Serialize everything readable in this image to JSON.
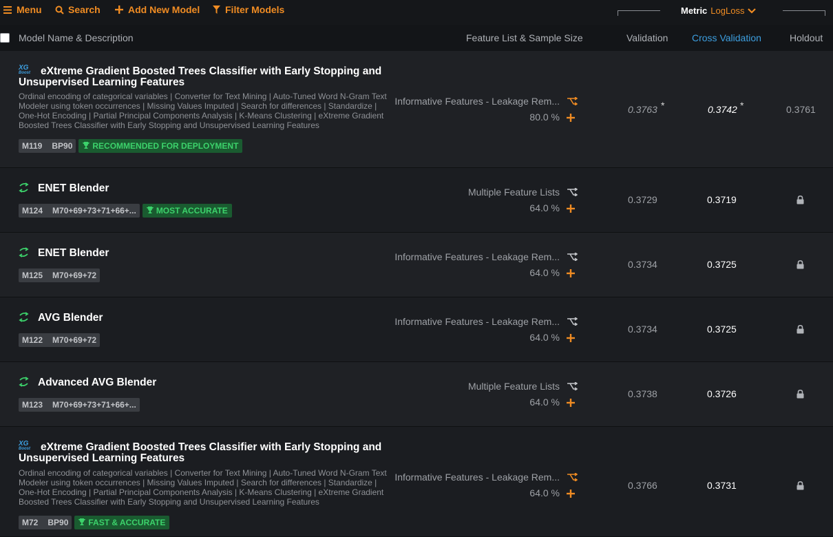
{
  "topbar": {
    "menu_label": "Menu",
    "search_label": "Search",
    "add_model_label": "Add New Model",
    "filter_label": "Filter Models",
    "metric_label": "Metric",
    "metric_value": "LogLoss"
  },
  "columns": {
    "model": "Model Name & Description",
    "feature": "Feature List & Sample Size",
    "validation": "Validation",
    "cross_validation": "Cross Validation",
    "holdout": "Holdout"
  },
  "rows": [
    {
      "icon": "xgboost-icon",
      "icon_text_top": "XG",
      "icon_text_bottom": "Boost",
      "title": "eXtreme Gradient Boosted Trees Classifier with Early Stopping and Unsupervised Learning Features",
      "description": "Ordinal encoding of categorical variables | Converter for Text Mining | Auto-Tuned Word N-Gram Text Modeler using token occurrences | Missing Values Imputed | Search for differences | Standardize | One-Hot Encoding | Partial Principal Components Analysis | K-Means Clustering | eXtreme Gradient Boosted Trees Classifier with Early Stopping and Unsupervised Learning Features",
      "badge_id": "M119",
      "badge_bp": "BP90",
      "tag": "RECOMMENDED FOR DEPLOYMENT",
      "feature_list": "Informative Features - Leakage Rem...",
      "sample_size": "80.0 %",
      "validation": "0.3763",
      "cross_validation": "0.3742",
      "holdout": "0.3761",
      "star": "*"
    },
    {
      "icon": "blender-icon",
      "title": "ENET Blender",
      "badge_id": "M124",
      "badge_bp": "M70+69+73+71+66+...",
      "tag": "MOST ACCURATE",
      "feature_list": "Multiple Feature Lists",
      "sample_size": "64.0 %",
      "validation": "0.3729",
      "cross_validation": "0.3719"
    },
    {
      "icon": "blender-icon",
      "title": "ENET Blender",
      "badge_id": "M125",
      "badge_bp": "M70+69+72",
      "feature_list": "Informative Features - Leakage Rem...",
      "sample_size": "64.0 %",
      "validation": "0.3734",
      "cross_validation": "0.3725"
    },
    {
      "icon": "blender-icon",
      "title": "AVG Blender",
      "badge_id": "M122",
      "badge_bp": "M70+69+72",
      "feature_list": "Informative Features - Leakage Rem...",
      "sample_size": "64.0 %",
      "validation": "0.3734",
      "cross_validation": "0.3725"
    },
    {
      "icon": "blender-icon",
      "title": "Advanced AVG Blender",
      "badge_id": "M123",
      "badge_bp": "M70+69+73+71+66+...",
      "feature_list": "Multiple Feature Lists",
      "sample_size": "64.0 %",
      "validation": "0.3738",
      "cross_validation": "0.3726"
    },
    {
      "icon": "xgboost-icon",
      "icon_text_top": "XG",
      "icon_text_bottom": "Boost",
      "title": "eXtreme Gradient Boosted Trees Classifier with Early Stopping and Unsupervised Learning Features",
      "description": "Ordinal encoding of categorical variables | Converter for Text Mining | Auto-Tuned Word N-Gram Text Modeler using token occurrences | Missing Values Imputed | Search for differences | Standardize | One-Hot Encoding | Partial Principal Components Analysis | K-Means Clustering | eXtreme Gradient Boosted Trees Classifier with Early Stopping and Unsupervised Learning Features",
      "badge_id": "M72",
      "badge_bp": "BP90",
      "tag": "FAST & ACCURATE",
      "feature_list": "Informative Features - Leakage Rem...",
      "sample_size": "64.0 %",
      "validation": "0.3766",
      "cross_validation": "0.3731"
    }
  ],
  "colors": {
    "accent": "#f08c23",
    "link": "#3d9fe0",
    "badge_green": "#3cd26b",
    "blender_green": "#3cd26b"
  }
}
